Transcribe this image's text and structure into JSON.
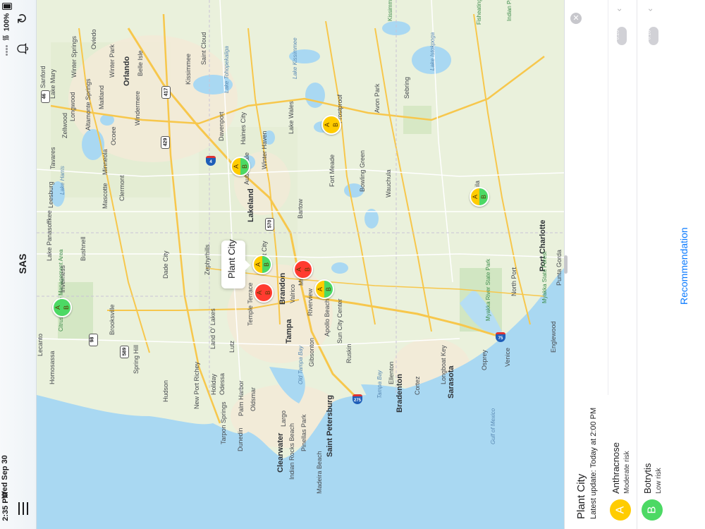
{
  "status": {
    "time": "2:35 PM",
    "date": "Wed Sep 30",
    "battery": "100%"
  },
  "app": {
    "title": "SAS"
  },
  "icons": {
    "refresh": "refresh-icon",
    "bell": "bell-icon",
    "menu": "menu-icon",
    "close": "close-icon",
    "chevron": "chevron-up-icon"
  },
  "colors": {
    "low": "#4cd964",
    "moderate": "#ffcc00",
    "high": "#ff3b30",
    "link": "#0a7aff"
  },
  "map": {
    "callout": "Plant City",
    "places": [
      {
        "label": "Sanford",
        "kind": "town"
      },
      {
        "label": "Lake Mary",
        "kind": "town"
      },
      {
        "label": "Winter Springs",
        "kind": "town"
      },
      {
        "label": "Oviedo",
        "kind": "town"
      },
      {
        "label": "Longwood",
        "kind": "town"
      },
      {
        "label": "Winter Park",
        "kind": "town"
      },
      {
        "label": "Altamonte Springs",
        "kind": "town"
      },
      {
        "label": "Maitland",
        "kind": "town"
      },
      {
        "label": "Orlando",
        "kind": "city"
      },
      {
        "label": "Belle Isle",
        "kind": "town"
      },
      {
        "label": "Zellwood",
        "kind": "town"
      },
      {
        "label": "Windermere",
        "kind": "town"
      },
      {
        "label": "Ocoee",
        "kind": "town"
      },
      {
        "label": "Kissimmee",
        "kind": "town"
      },
      {
        "label": "Saint Cloud",
        "kind": "town"
      },
      {
        "label": "Lake Tohopekaliga",
        "kind": "water"
      },
      {
        "label": "Lake Kissimmee",
        "kind": "water"
      },
      {
        "label": "Lake Istokpoga",
        "kind": "water"
      },
      {
        "label": "Tavares",
        "kind": "town"
      },
      {
        "label": "Minneola",
        "kind": "town"
      },
      {
        "label": "Leesburg",
        "kind": "town"
      },
      {
        "label": "Lake Harris",
        "kind": "water"
      },
      {
        "label": "Mascotte",
        "kind": "town"
      },
      {
        "label": "Clermont",
        "kind": "town"
      },
      {
        "label": "Davenport",
        "kind": "town"
      },
      {
        "label": "Haines City",
        "kind": "town"
      },
      {
        "label": "Winter Haven",
        "kind": "town"
      },
      {
        "label": "Auburndale",
        "kind": "town"
      },
      {
        "label": "Lake Wales",
        "kind": "town"
      },
      {
        "label": "Avon Park",
        "kind": "town"
      },
      {
        "label": "Sebring",
        "kind": "town"
      },
      {
        "label": "Frostproof",
        "kind": "town"
      },
      {
        "label": "Lakeland",
        "kind": "city"
      },
      {
        "label": "Fort Meade",
        "kind": "town"
      },
      {
        "label": "Bowling Green",
        "kind": "town"
      },
      {
        "label": "Wauchula",
        "kind": "town"
      },
      {
        "label": "Bartow",
        "kind": "town"
      },
      {
        "label": "Plant City",
        "kind": "town"
      },
      {
        "label": "Mulberry",
        "kind": "town"
      },
      {
        "label": "Lake Panasoffkee",
        "kind": "town"
      },
      {
        "label": "Bushnell",
        "kind": "town"
      },
      {
        "label": "Dade City",
        "kind": "town"
      },
      {
        "label": "Zephyrhills",
        "kind": "town"
      },
      {
        "label": "Temple Terrace",
        "kind": "town"
      },
      {
        "label": "Brandon",
        "kind": "city"
      },
      {
        "label": "Valrico",
        "kind": "town"
      },
      {
        "label": "Riverview",
        "kind": "town"
      },
      {
        "label": "Apollo Beach",
        "kind": "town"
      },
      {
        "label": "Sun City Center",
        "kind": "town"
      },
      {
        "label": "Tampa",
        "kind": "city"
      },
      {
        "label": "Citrus Wildlife Management Area",
        "kind": "park"
      },
      {
        "label": "Inverness",
        "kind": "town"
      },
      {
        "label": "Brooksville",
        "kind": "town"
      },
      {
        "label": "Lecanto",
        "kind": "town"
      },
      {
        "label": "Homosassa",
        "kind": "town"
      },
      {
        "label": "Spring Hill",
        "kind": "town"
      },
      {
        "label": "Land O' Lakes",
        "kind": "town"
      },
      {
        "label": "Lutz",
        "kind": "town"
      },
      {
        "label": "Hudson",
        "kind": "town"
      },
      {
        "label": "New Port Richey",
        "kind": "town"
      },
      {
        "label": "Holiday",
        "kind": "town"
      },
      {
        "label": "Odessa",
        "kind": "town"
      },
      {
        "label": "Palm Harbor",
        "kind": "town"
      },
      {
        "label": "Oldsmar",
        "kind": "town"
      },
      {
        "label": "Tarpon Springs",
        "kind": "town"
      },
      {
        "label": "Dunedin",
        "kind": "town"
      },
      {
        "label": "Clearwater",
        "kind": "city"
      },
      {
        "label": "Largo",
        "kind": "town"
      },
      {
        "label": "Pinellas Park",
        "kind": "town"
      },
      {
        "label": "Indian Rocks Beach",
        "kind": "town"
      },
      {
        "label": "Madeira Beach",
        "kind": "town"
      },
      {
        "label": "Saint Petersburg",
        "kind": "city"
      },
      {
        "label": "Gibsonton",
        "kind": "town"
      },
      {
        "label": "Ruskin",
        "kind": "town"
      },
      {
        "label": "Old Tampa Bay",
        "kind": "water"
      },
      {
        "label": "Tampa Bay",
        "kind": "water"
      },
      {
        "label": "Ellenton",
        "kind": "town"
      },
      {
        "label": "Bradenton",
        "kind": "city"
      },
      {
        "label": "Cortez",
        "kind": "town"
      },
      {
        "label": "Longboat Key",
        "kind": "town"
      },
      {
        "label": "Sarasota",
        "kind": "city"
      },
      {
        "label": "Osprey",
        "kind": "town"
      },
      {
        "label": "Venice",
        "kind": "town"
      },
      {
        "label": "Englewood",
        "kind": "town"
      },
      {
        "label": "North Port",
        "kind": "town"
      },
      {
        "label": "Port Charlotte",
        "kind": "city"
      },
      {
        "label": "Punta Gorda",
        "kind": "town"
      },
      {
        "label": "Myakka River State Park",
        "kind": "park"
      },
      {
        "label": "Myakka State Forest",
        "kind": "park"
      },
      {
        "label": "Gulf of Mexico",
        "kind": "water"
      },
      {
        "label": "Kissimmee Prairie Preserve",
        "kind": "park"
      },
      {
        "label": "Fisheating Creek",
        "kind": "park"
      },
      {
        "label": "Indian Prairie",
        "kind": "park"
      },
      {
        "label": "ila",
        "kind": "town"
      }
    ],
    "highways": [
      "46",
      "417",
      "429",
      "4",
      "570",
      "98",
      "589",
      "75",
      "275"
    ],
    "markers": [
      {
        "label_a": "A",
        "label_b": "B",
        "a": "low",
        "b": "low"
      },
      {
        "label_a": "A",
        "label_b": "B",
        "a": "moderate",
        "b": "low"
      },
      {
        "label_a": "A",
        "label_b": "B",
        "a": "moderate",
        "b": "moderate"
      },
      {
        "label_a": "A",
        "label_b": "B",
        "a": "moderate",
        "b": "low"
      },
      {
        "label_a": "A",
        "label_b": "B",
        "a": "moderate",
        "b": "low"
      },
      {
        "label_a": "A",
        "label_b": "B",
        "a": "high",
        "b": "high"
      },
      {
        "label_a": "A",
        "label_b": "B",
        "a": "high",
        "b": "high"
      },
      {
        "label_a": "A",
        "label_b": "B",
        "a": "moderate",
        "b": "low"
      }
    ]
  },
  "panel": {
    "title": "Plant City",
    "updated": "Latest update: Today at 2:00 PM",
    "diseases": [
      {
        "letter": "A",
        "name": "Anthracnose",
        "risk": "Moderate risk",
        "level": "moderate"
      },
      {
        "letter": "B",
        "name": "Botrytis",
        "risk": "Low risk",
        "level": "low"
      }
    ],
    "pills": [
      "0.26",
      "0.18"
    ],
    "recommendation": "Recommendation"
  }
}
